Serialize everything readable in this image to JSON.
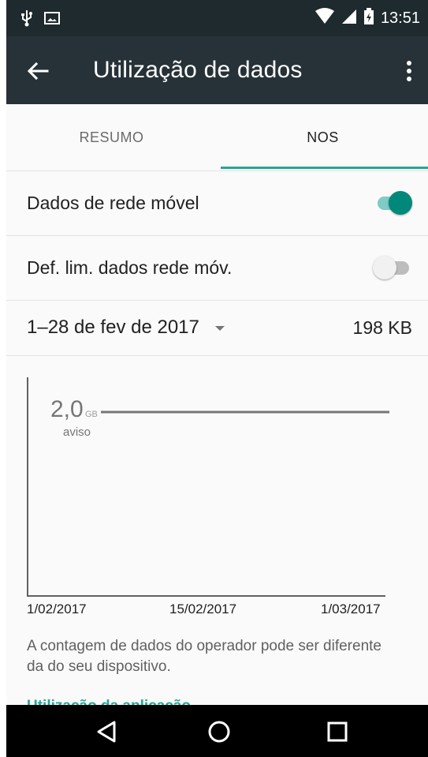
{
  "status_bar": {
    "time": "13:51",
    "icons": [
      "usb-icon",
      "image-notification-icon",
      "wifi-icon",
      "cell-signal-icon",
      "battery-charging-icon"
    ]
  },
  "toolbar": {
    "title": "Utilização de dados",
    "back_icon": "arrow-back-icon",
    "menu_icon": "more-vert-icon",
    "background": "#263238"
  },
  "tabs": [
    {
      "label": "RESUMO",
      "selected": false
    },
    {
      "label": "NOS",
      "selected": true
    }
  ],
  "settings": {
    "mobile_data": {
      "label": "Dados de rede móvel",
      "enabled": true
    },
    "data_limit": {
      "label": "Def. lim. dados rede móv.",
      "enabled": false
    }
  },
  "cycle": {
    "range": "1–28 de fev de 2017",
    "total": "198 KB"
  },
  "chart": {
    "warning_value": "2,0",
    "warning_unit": "GB",
    "warning_label": "aviso",
    "x_labels": [
      "1/02/2017",
      "15/02/2017",
      "1/03/2017"
    ]
  },
  "chart_data": {
    "type": "line",
    "x": [
      "1/02/2017",
      "15/02/2017",
      "1/03/2017"
    ],
    "series": [
      {
        "values": [
          2.0,
          2.0,
          2.0
        ]
      }
    ],
    "xlabel": "",
    "ylabel": ""
  },
  "footer": {
    "note": "A contagem de dados do operador pode ser diferente da do seu dispositivo.",
    "app_usage_heading": "Utilização da aplicação"
  },
  "nav": {
    "back_icon": "nav-back-icon",
    "home_icon": "nav-home-icon",
    "recents_icon": "nav-recents-icon"
  },
  "colors": {
    "accent": "#26a69a",
    "statusbar": "#1f2a2e"
  }
}
